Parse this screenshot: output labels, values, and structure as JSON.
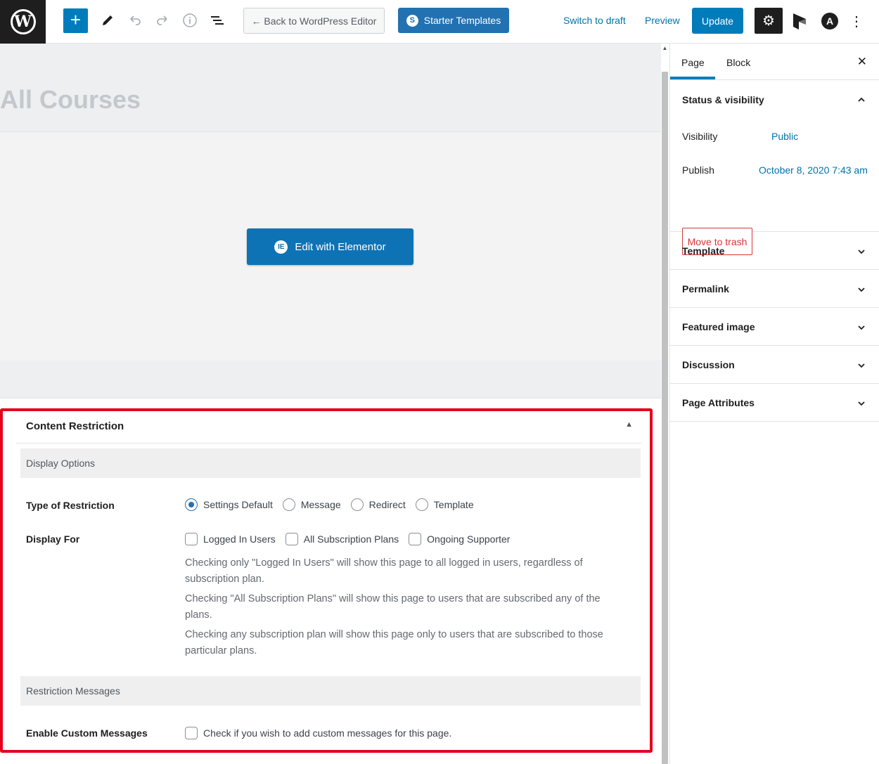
{
  "topbar": {
    "back_label": "← Back to WordPress Editor",
    "starter_label": "Starter Templates",
    "switch_draft": "Switch to draft",
    "preview": "Preview",
    "update": "Update"
  },
  "editor": {
    "page_title": "All Courses",
    "elementor_button": "Edit with Elementor"
  },
  "restriction": {
    "title": "Content Restriction",
    "display_options": "Display Options",
    "type_label": "Type of Restriction",
    "type_options": [
      "Settings Default",
      "Message",
      "Redirect",
      "Template"
    ],
    "type_selected": "Settings Default",
    "display_for_label": "Display For",
    "display_for_options": [
      "Logged In Users",
      "All Subscription Plans",
      "Ongoing Supporter"
    ],
    "help_1": "Checking only \"Logged In Users\" will show this page to all logged in users, regardless of subscription plan.",
    "help_2": "Checking \"All Subscription Plans\" will show this page to users that are subscribed any of the plans.",
    "help_3": "Checking any subscription plan will show this page only to users that are subscribed to those particular plans.",
    "restriction_messages": "Restriction Messages",
    "enable_custom_label": "Enable Custom Messages",
    "enable_custom_text": "Check if you wish to add custom messages for this page."
  },
  "sidebar": {
    "tab_page": "Page",
    "tab_block": "Block",
    "status_title": "Status & visibility",
    "visibility_label": "Visibility",
    "visibility_value": "Public",
    "publish_label": "Publish",
    "publish_value": "October 8, 2020 7:43 am",
    "trash_label": "Move to trash",
    "sections": [
      "Template",
      "Permalink",
      "Featured image",
      "Discussion",
      "Page Attributes"
    ]
  },
  "colors": {
    "accent": "#007cba",
    "highlight_border": "#e3001b",
    "trash": "#d63638"
  }
}
